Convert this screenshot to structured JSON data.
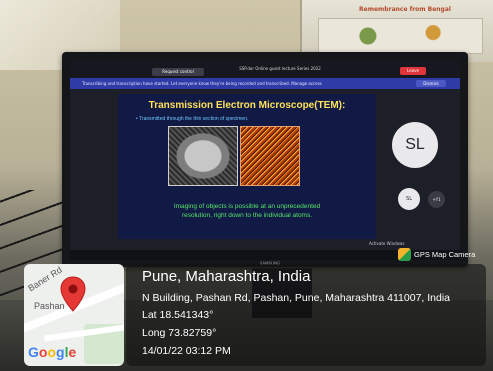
{
  "poster": {
    "title": "Remembrance from Bengal"
  },
  "zoom": {
    "title": "SSP.dor Online guest lecture Series 2022",
    "recording_label": "Request control",
    "banner_text": "Transcribing and transcription have started. Let everyone know they're being recorded and transcribed. Manage access",
    "dismiss_label": "Dismiss",
    "leave_label": "Leave"
  },
  "slide": {
    "title": "Transmission Electron Microscope(TEM):",
    "bullet": "• Transmitted through the thin section of specimen.",
    "caption_line1": "Imaging of objects is possible at an unprecedented",
    "caption_line2": "resolution, right down to the individual atoms."
  },
  "participants": {
    "main_initials": "SL",
    "small1": "SL",
    "small2": "+Y1"
  },
  "windows_notice": "Activate Windows",
  "monitor_brand": "SAMSUNG",
  "gps_camera": {
    "logo_text": "GPS Map Camera",
    "city": "Pune, Maharashtra, India",
    "address": "N Building, Pashan Rd, Pashan, Pune, Maharashtra 411007, India",
    "lat": "Lat 18.541343°",
    "long": "Long 73.82759°",
    "datetime": "14/01/22 03:12 PM"
  },
  "map": {
    "road_label": "Baner Rd",
    "area_label": "Pashan",
    "provider": "Google"
  },
  "colors": {
    "slide_title": "#ffe15a",
    "slide_caption": "#58e46a",
    "slide_background": "#101a45",
    "zoom_banner": "#2f3ca8",
    "pin_red": "#e53935"
  }
}
